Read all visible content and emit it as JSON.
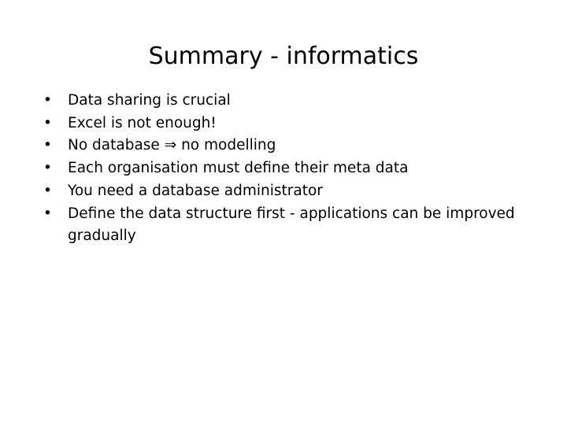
{
  "slide": {
    "title": "Summary - informatics",
    "background_color": "#ffffff",
    "text_color": "#000000",
    "bullet_marker": "•",
    "bullets": [
      {
        "text": "Data sharing is crucial"
      },
      {
        "text": "Excel is not enough!"
      },
      {
        "text": "No database ⇒ no modelling"
      },
      {
        "text": "Each organisation must define their meta data"
      },
      {
        "text": "You need a database administrator"
      },
      {
        "text": "Define the data structure first - applications can be improved gradually"
      }
    ]
  }
}
